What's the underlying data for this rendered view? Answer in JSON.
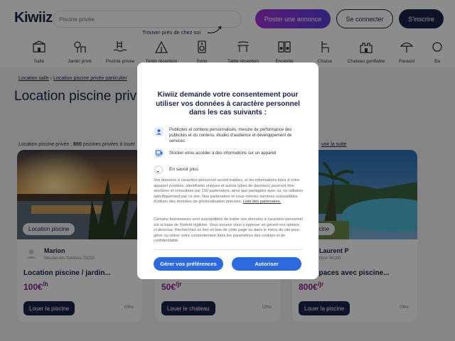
{
  "header": {
    "logo": "Kiwiiz",
    "search_placeholder": "Piscine privée",
    "post_label": "Poster une annonce",
    "login_label": "Se connecter",
    "signup_label": "S'inscrire",
    "nearby_hint": "Trouver près de chez soi"
  },
  "categories": [
    {
      "label": "Salle",
      "icon": "hall-icon"
    },
    {
      "label": "Jardin privé",
      "icon": "garden-icon"
    },
    {
      "label": "Piscine privée",
      "icon": "pool-icon"
    },
    {
      "label": "Tente réception",
      "icon": "tent-icon"
    },
    {
      "label": "Sono",
      "icon": "speaker-icon"
    },
    {
      "label": "Table réception",
      "icon": "table-icon"
    },
    {
      "label": "Enceinte",
      "icon": "loudspeaker-icon"
    },
    {
      "label": "Chaise",
      "icon": "chair-icon"
    },
    {
      "label": "Chateau gonflable",
      "icon": "bouncy-castle-icon"
    },
    {
      "label": "Parasol",
      "icon": "parasol-icon"
    },
    {
      "label": "Ba",
      "icon": "more-icon"
    }
  ],
  "breadcrumb": {
    "item1": "Location salle",
    "sep": " › ",
    "item2": "Location piscine privée particulier"
  },
  "page_title": "Location piscine priv",
  "results": {
    "prefix": "Location piscine privée : ",
    "count": "800",
    "suffix": " piscines privées à louer",
    "see_more": "voir la suite"
  },
  "cards": [
    {
      "tag": "Location piscine",
      "owner": "Marion",
      "city": "Meulan-en-Yvelines 78250",
      "title": "Location piscine / jardin...",
      "price": "100€",
      "unit": "/h",
      "button": "Louer la piscine",
      "offer": "Offre"
    },
    {
      "tag": "",
      "owner": "",
      "city": "",
      "title": "",
      "price": "50€",
      "unit": "/jr",
      "button": "Louer le chateau",
      "offer": "Offre"
    },
    {
      "tag": "on piscine",
      "owner": "Laurent P",
      "city": "Nice 06100",
      "title": "n d'espaces avec piscine...",
      "price": "800€",
      "unit": "/jr",
      "button": "Louer la piscine",
      "offer": "Offre"
    }
  ],
  "consent": {
    "title": "Kiwiiz demande votre consentement pour utiliser vos données à caractère personnel dans les cas suivants :",
    "purpose1": "Publicités et contenu personnalisés, mesure de performance des publicités et du contenu, études d'audience et développement de services",
    "purpose2": "Stocker et/ou accéder à des informations sur un appareil",
    "learn_more": "En savoir plus",
    "para1": "Vos données à caractère personnel seront traitées, et les informations liées à votre appareil (cookies, identifiants uniques et autres types de données) pourront être stockées et consultées par 210 partenaires, ainsi que partagées avec lui, ou utilisées spécifiquement par ce site. Nos partenaires et nous-mêmes sommes susceptibles d'utiliser des données de géolocalisation précises.",
    "partners_link": "Liste des partenaires.",
    "para2": "Certains fournisseurs sont susceptibles de traiter vos données à caractère personnel sur la base de l'intérêt légitime. Vous pouvez vous y opposer en gérant vos options ci-dessous. Recherchez un lien en bas de cette page ou dans le menu du site pour gérer ou retirer votre consentement dans les paramètres des cookies et de confidentialité.",
    "prefs_label": "Gérer vos préférences",
    "accept_label": "Autoriser"
  },
  "colors": {
    "navy": "#1b2347",
    "purple": "#7b3fe4",
    "blue_button": "#2d6ae0",
    "price": "#8a1f8a"
  }
}
